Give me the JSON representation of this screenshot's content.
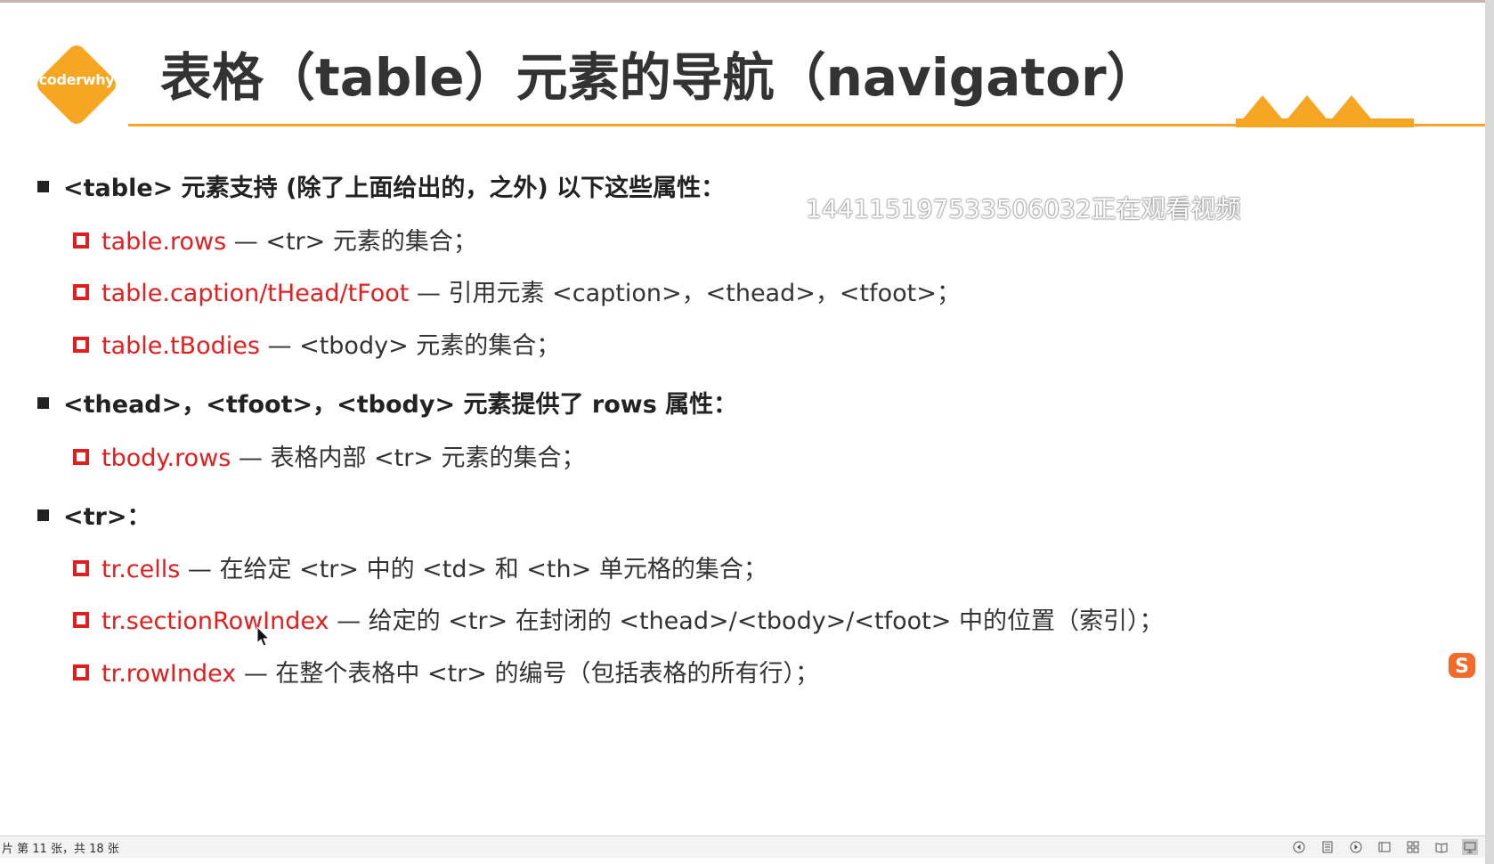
{
  "slide": {
    "logo_text": "coderwhy",
    "title": "表格（table）元素的导航（navigator）",
    "watermark": "144115197533506032正在观看视频"
  },
  "sections": [
    {
      "heading": "<table> 元素支持 (除了上面给出的，之外) 以下这些属性：",
      "items": [
        {
          "key": "table.rows",
          "desc": " — <tr> 元素的集合；"
        },
        {
          "key": "table.caption/tHead/tFoot",
          "desc": " — 引用元素 <caption>，<thead>，<tfoot>；"
        },
        {
          "key": "table.tBodies",
          "desc": " — <tbody> 元素的集合；"
        }
      ]
    },
    {
      "heading": "<thead>，<tfoot>，<tbody> 元素提供了 rows 属性：",
      "items": [
        {
          "key": "tbody.rows",
          "desc": " — 表格内部 <tr> 元素的集合；"
        }
      ]
    },
    {
      "heading": "<tr>：",
      "items": [
        {
          "key": "tr.cells",
          "desc": " — 在给定 <tr> 中的 <td> 和 <th> 单元格的集合；"
        },
        {
          "key": "tr.sectionRowIndex",
          "desc": " — 给定的 <tr> 在封闭的 <thead>/<tbody>/<tfoot> 中的位置（索引）；"
        },
        {
          "key": "tr.rowIndex",
          "desc": " — 在整个表格中 <tr> 的编号（包括表格的所有行）；"
        }
      ]
    }
  ],
  "statusbar": {
    "slide_info": "片 第 11 张，共 18 张",
    "icons": [
      "prev-slide-icon",
      "notes-icon",
      "next-slide-icon",
      "normal-view-icon",
      "slide-sorter-icon",
      "reading-view-icon",
      "slideshow-icon"
    ]
  },
  "colors": {
    "accent": "#f6a623",
    "key_red": "#e02020",
    "text": "#333333"
  }
}
